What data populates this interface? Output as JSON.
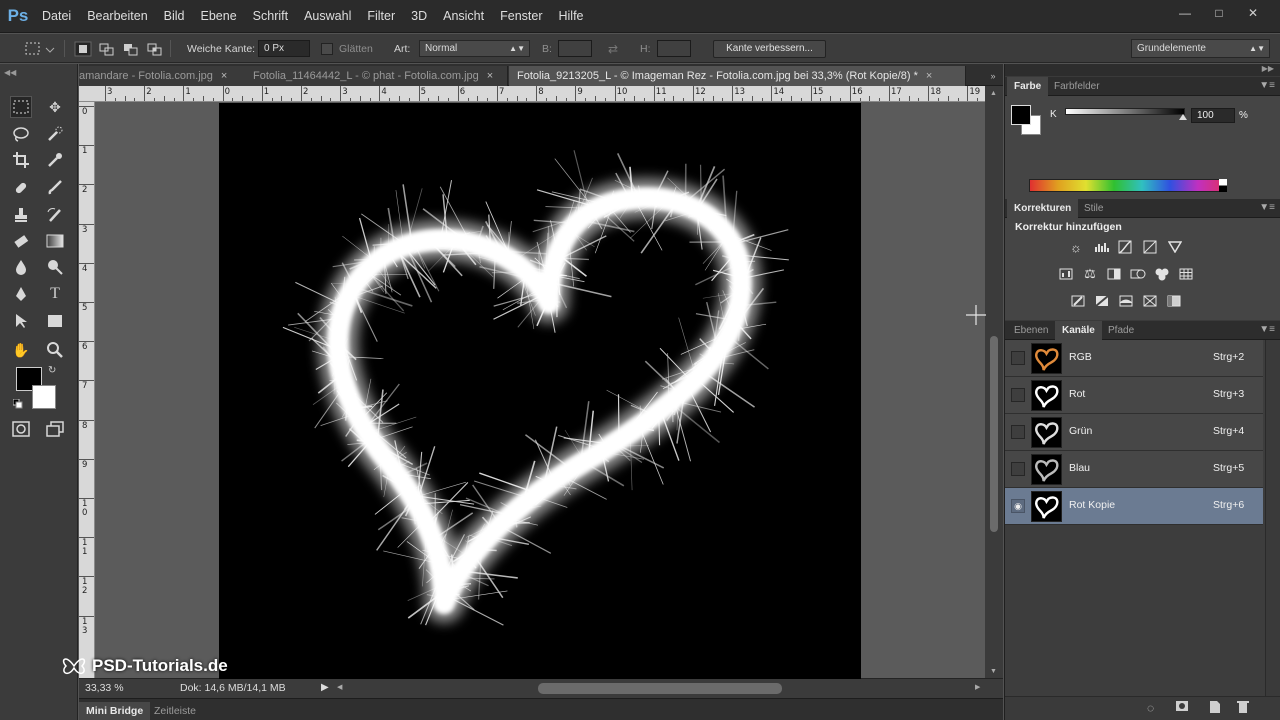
{
  "app": {
    "logo": "Ps"
  },
  "menu": [
    "Datei",
    "Bearbeiten",
    "Bild",
    "Ebene",
    "Schrift",
    "Auswahl",
    "Filter",
    "3D",
    "Ansicht",
    "Fenster",
    "Hilfe"
  ],
  "window_controls": [
    "minimize-icon",
    "restore-icon",
    "close-icon"
  ],
  "options": {
    "feather_label": "Weiche Kante:",
    "feather_value": "0 Px",
    "antialias_label": "Glätten",
    "style_label": "Art:",
    "style_value": "Normal",
    "width_label": "B:",
    "height_label": "H:",
    "refine_button": "Kante verbessern...",
    "workspace": "Grundelemente"
  },
  "tabs": [
    {
      "label": "amandare - Fotolia.com.jpg",
      "close": "×"
    },
    {
      "label": "Fotolia_11464442_L - © phat - Fotolia.com.jpg",
      "close": "×"
    },
    {
      "label": "Fotolia_9213205_L - © Imageman Rez - Fotolia.com.jpg bei 33,3% (Rot Kopie/8) *",
      "close": "×"
    }
  ],
  "ruler_top": [
    "3",
    "2",
    "1",
    "0",
    "1",
    "2",
    "3",
    "4",
    "5",
    "6",
    "7",
    "8",
    "9",
    "10",
    "11",
    "12",
    "13",
    "14",
    "15",
    "16",
    "17",
    "18",
    "19"
  ],
  "ruler_left": [
    "0",
    "1",
    "2",
    "3",
    "4",
    "5",
    "6",
    "7",
    "8",
    "9",
    "1 0",
    "1 1",
    "1 2",
    "1 3"
  ],
  "status": {
    "zoom": "33,33 %",
    "docsize": "Dok: 14,6 MB/14,1 MB"
  },
  "bottom_tabs": [
    "Mini Bridge",
    "Zeitleiste"
  ],
  "watermark": "PSD-Tutorials.de",
  "color_panel": {
    "tabs": [
      "Farbe",
      "Farbfelder"
    ],
    "channel_label": "K",
    "value": "100",
    "unit": "%",
    "foreground": "#000000",
    "background": "#ffffff"
  },
  "adjustments_panel": {
    "tabs": [
      "Korrekturen",
      "Stile"
    ],
    "title": "Korrektur hinzufügen",
    "icons_row1": [
      "brightness-icon",
      "levels-icon",
      "curves-icon",
      "exposure-icon",
      "vibrance-icon"
    ],
    "icons_row2": [
      "hue-saturation-icon",
      "color-balance-icon",
      "black-white-icon",
      "photo-filter-icon",
      "channel-mixer-icon",
      "color-lookup-icon"
    ],
    "icons_row3": [
      "invert-icon",
      "posterize-icon",
      "threshold-icon",
      "selective-color-icon",
      "gradient-map-icon"
    ]
  },
  "channels_panel": {
    "tabs": [
      "Ebenen",
      "Kanäle",
      "Pfade"
    ],
    "channels": [
      {
        "name": "RGB",
        "shortcut": "Strg+2",
        "visible": false,
        "selected": false,
        "tint": "#e08a3a"
      },
      {
        "name": "Rot",
        "shortcut": "Strg+3",
        "visible": false,
        "selected": false,
        "tint": "#ffffff"
      },
      {
        "name": "Grün",
        "shortcut": "Strg+4",
        "visible": false,
        "selected": false,
        "tint": "#dddddd"
      },
      {
        "name": "Blau",
        "shortcut": "Strg+5",
        "visible": false,
        "selected": false,
        "tint": "#bbbbbb"
      },
      {
        "name": "Rot Kopie",
        "shortcut": "Strg+6",
        "visible": true,
        "selected": true,
        "tint": "#ffffff"
      }
    ]
  }
}
